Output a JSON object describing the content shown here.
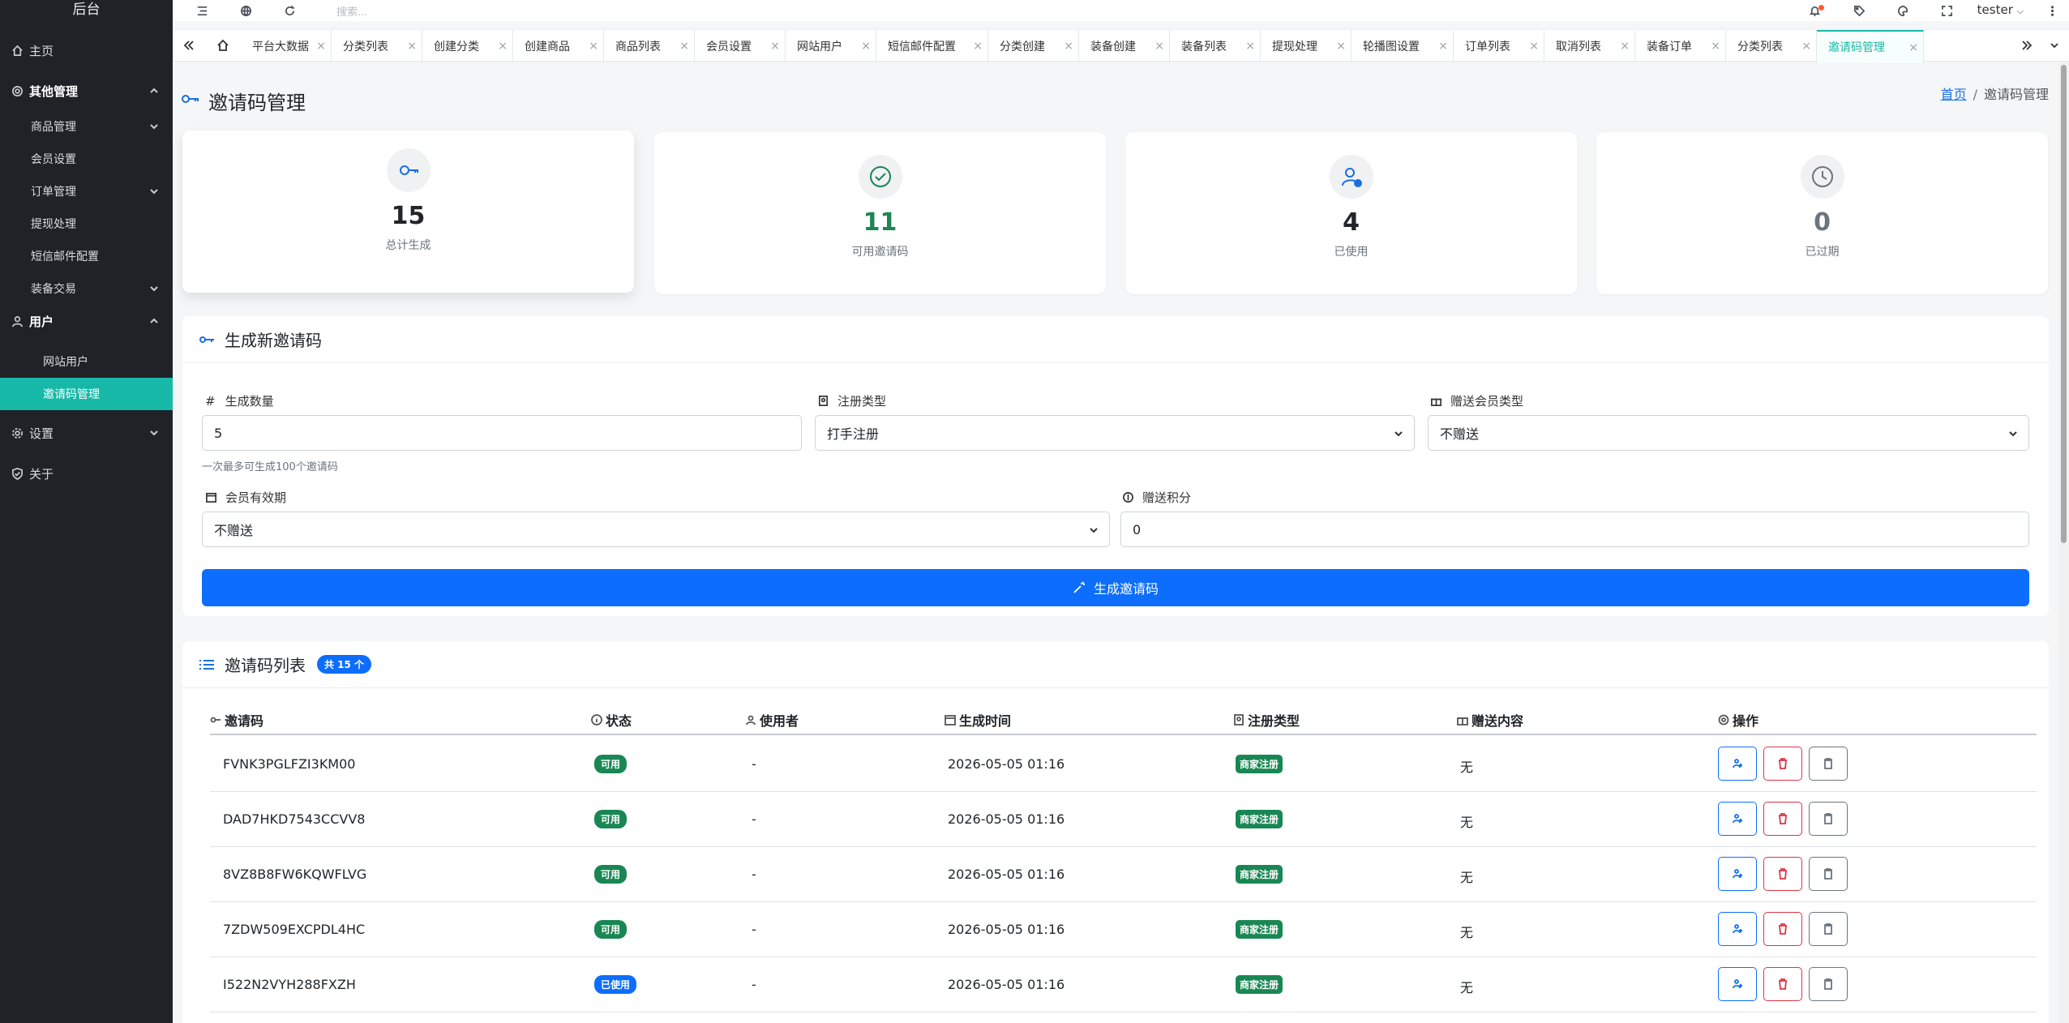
{
  "sidebar": {
    "brand": "后台",
    "home": "主页",
    "other_mgmt": "其他管理",
    "goods_mgmt": "商品管理",
    "member_settings": "会员设置",
    "order_mgmt": "订单管理",
    "withdraw": "提现处理",
    "sms_mail": "短信邮件配置",
    "equip_trade": "装备交易",
    "users": "用户",
    "site_users": "网站用户",
    "invite_mgmt": "邀请码管理",
    "settings": "设置",
    "about": "关于"
  },
  "topbar": {
    "search_placeholder": "搜索...",
    "username": "tester"
  },
  "tabs": [
    "平台大数据",
    "分类列表",
    "创建分类",
    "创建商品",
    "商品列表",
    "会员设置",
    "网站用户",
    "短信邮件配置",
    "分类创建",
    "装备创建",
    "装备列表",
    "提现处理",
    "轮播图设置",
    "订单列表",
    "取消列表",
    "装备订单",
    "分类列表",
    "邀请码管理"
  ],
  "page": {
    "title": "邀请码管理",
    "breadcrumb_home": "首页",
    "breadcrumb_sep": "/",
    "breadcrumb_current": "邀请码管理"
  },
  "stats": {
    "total": {
      "value": "15",
      "label": "总计生成",
      "color": "#212529"
    },
    "available": {
      "value": "11",
      "label": "可用邀请码",
      "color": "#198754"
    },
    "used": {
      "value": "4",
      "label": "已使用",
      "color": "#212529"
    },
    "expired": {
      "value": "0",
      "label": "已过期",
      "color": "#6c757d"
    }
  },
  "generate": {
    "title": "生成新邀请码",
    "qty_label": "生成数量",
    "qty_value": "5",
    "qty_hint": "一次最多可生成100个邀请码",
    "reg_type_label": "注册类型",
    "reg_type_value": "打手注册",
    "gift_member_label": "赠送会员类型",
    "gift_member_value": "不赠送",
    "member_validity_label": "会员有效期",
    "member_validity_value": "不赠送",
    "gift_points_label": "赠送积分",
    "gift_points_value": "0",
    "submit_label": "生成邀请码"
  },
  "list": {
    "title": "邀请码列表",
    "count_badge": "共 15 个",
    "columns": [
      "邀请码",
      "状态",
      "使用者",
      "生成时间",
      "注册类型",
      "赠送内容",
      "操作"
    ],
    "rows": [
      {
        "code": "FVNK3PGLFZI3KM00",
        "status": "可用",
        "user": "-",
        "time": "2026-05-05 01:16",
        "reg_type": "商家注册",
        "gift": "无"
      },
      {
        "code": "DAD7HKD7543CCVV8",
        "status": "可用",
        "user": "-",
        "time": "2026-05-05 01:16",
        "reg_type": "商家注册",
        "gift": "无"
      },
      {
        "code": "8VZ8B8FW6KQWFLVG",
        "status": "可用",
        "user": "-",
        "time": "2026-05-05 01:16",
        "reg_type": "商家注册",
        "gift": "无"
      },
      {
        "code": "7ZDW509EXCPDL4HC",
        "status": "可用",
        "user": "-",
        "time": "2026-05-05 01:16",
        "reg_type": "商家注册",
        "gift": "无"
      },
      {
        "code": "I522N2VYH288FXZH",
        "status": "已使用",
        "user": "-",
        "time": "2026-05-05 01:16",
        "reg_type": "商家注册",
        "gift": "无"
      }
    ]
  },
  "colors": {
    "sidebar_bg": "#1f2328",
    "active_teal": "#18b8a8",
    "primary": "#0d6efd",
    "success": "#198754",
    "danger": "#dc3545"
  }
}
